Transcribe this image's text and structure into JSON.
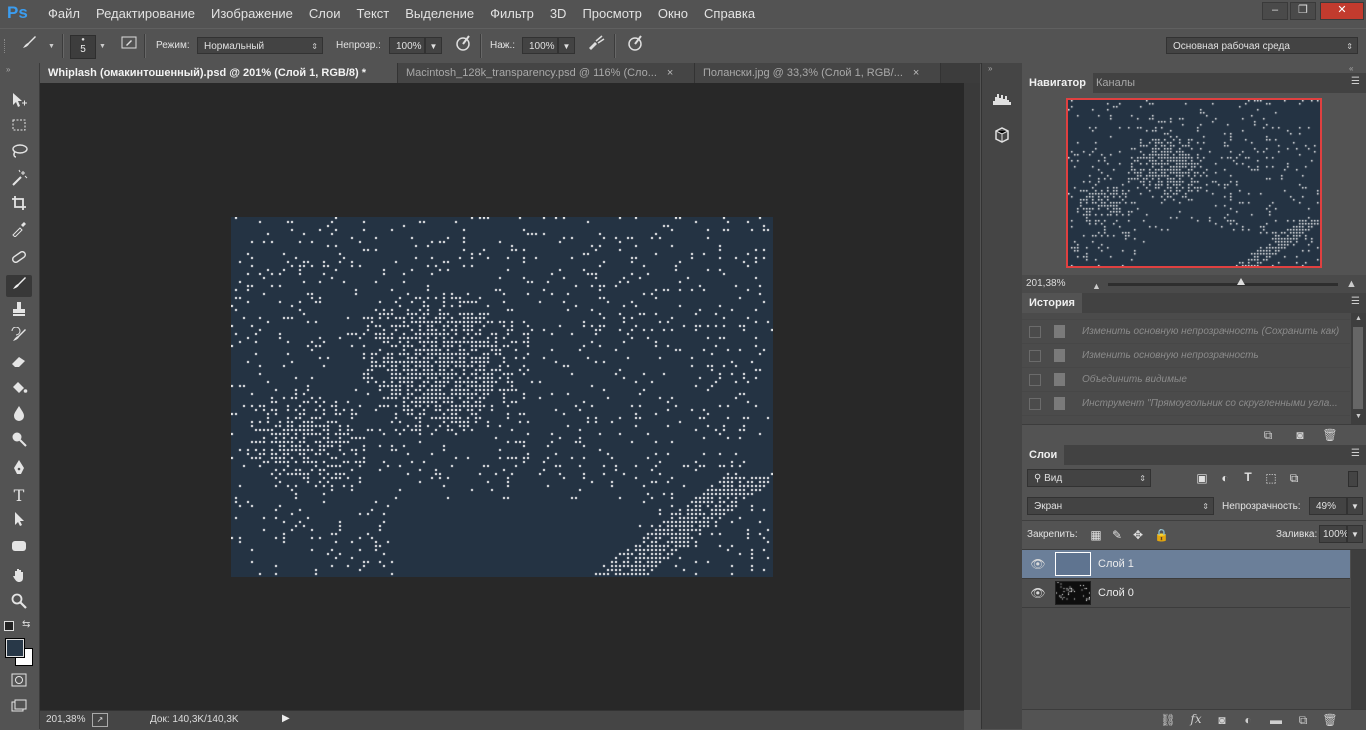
{
  "app": {
    "logo": "Ps"
  },
  "menu": [
    "Файл",
    "Редактирование",
    "Изображение",
    "Слои",
    "Текст",
    "Выделение",
    "Фильтр",
    "3D",
    "Просмотр",
    "Окно",
    "Справка"
  ],
  "window_controls": {
    "minimize": "–",
    "restore": "❐",
    "close": "✕"
  },
  "options_bar": {
    "brush_size": "5",
    "mode_label": "Режим:",
    "mode_value": "Нормальный",
    "opacity_label": "Непрозр.:",
    "opacity_value": "100%",
    "pressure_label": "Наж.:",
    "pressure_value": "100%",
    "workspace_value": "Основная рабочая среда"
  },
  "doc_tabs": [
    {
      "label": "Whiplash (омакинтошенный).psd @ 201% (Слой 1, RGB/8) *",
      "close": "×",
      "active": true
    },
    {
      "label": "Macintosh_128k_transparency.psd @ 116% (Сло...",
      "close": "×",
      "active": false
    },
    {
      "label": "Полански.jpg @ 33,3% (Слой 1, RGB/...",
      "close": "×",
      "active": false
    }
  ],
  "status_bar": {
    "zoom": "201,38%",
    "doc_info": "Док: 140,3K/140,3K"
  },
  "navigator": {
    "tabs": [
      "Навигатор",
      "Каналы"
    ],
    "zoom": "201,38%",
    "slider_position": 0.58
  },
  "history": {
    "title": "История",
    "items": [
      "Изменить основную непрозрачность (Сохранить как)",
      "Изменить основную непрозрачность",
      "Объединить видимые",
      "Инструмент \"Прямоугольник со скругленными угла..."
    ]
  },
  "layers": {
    "title": "Слои",
    "filter_value": "Вид",
    "blend_mode": "Экран",
    "opacity_label": "Непрозрачность:",
    "opacity_value": "49%",
    "lock_label": "Закрепить:",
    "fill_label": "Заливка:",
    "fill_value": "100%",
    "items": [
      {
        "name": "Слой 1",
        "selected": true
      },
      {
        "name": "Слой 0",
        "selected": false
      }
    ]
  },
  "colors": {
    "foreground": "#283848",
    "background": "#ffffff",
    "image_bg": "#243343",
    "navigator_frame": "#e04040",
    "selected_layer": "#6b7f99"
  }
}
